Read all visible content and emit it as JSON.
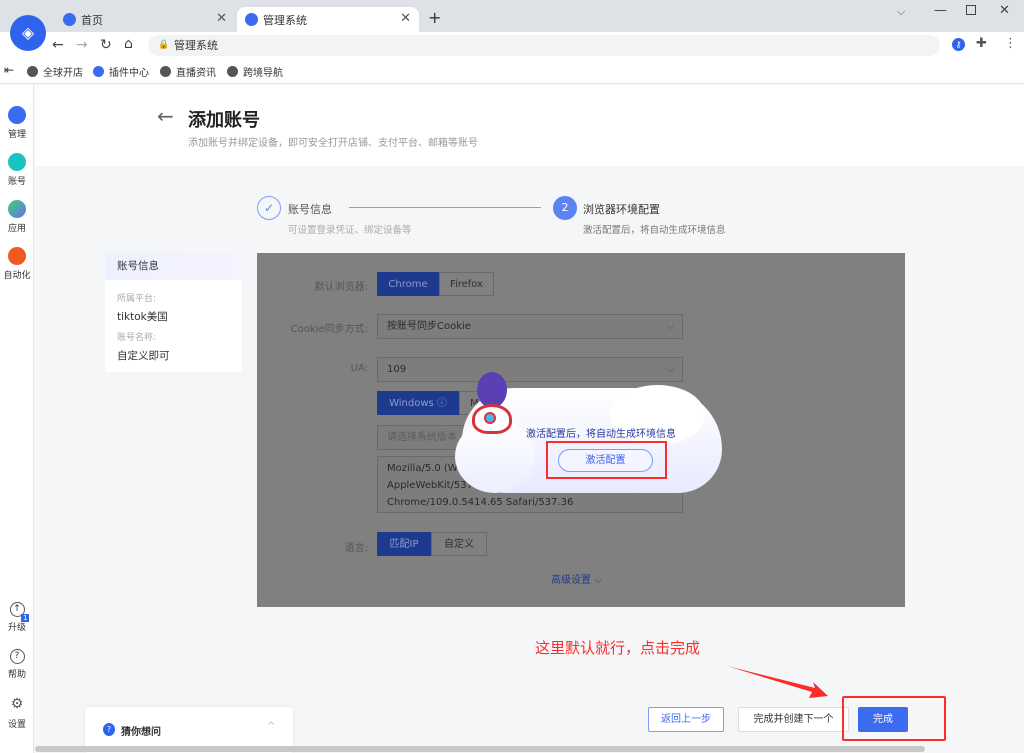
{
  "browser": {
    "tabs": [
      {
        "label": "首页",
        "active": false
      },
      {
        "label": "管理系统",
        "active": true
      }
    ],
    "address": "管理系统",
    "bookmarks": [
      "全球开店",
      "插件中心",
      "直播资讯",
      "跨境导航"
    ]
  },
  "sidebar": {
    "items": [
      {
        "label": "管理",
        "icon": "grid-icon"
      },
      {
        "label": "账号",
        "icon": "shop-icon"
      },
      {
        "label": "应用",
        "icon": "apps-icon"
      },
      {
        "label": "自动化",
        "icon": "robot-icon"
      }
    ],
    "bottom": [
      {
        "label": "升级",
        "badge": "1"
      },
      {
        "label": "帮助"
      },
      {
        "label": "设置"
      }
    ]
  },
  "header": {
    "title": "添加账号",
    "subtitle": "添加账号并绑定设备，即可安全打开店铺、支付平台、邮箱等账号"
  },
  "steps": [
    {
      "number": "1",
      "title": "账号信息",
      "desc": "可设置登录凭证、绑定设备等",
      "done": true
    },
    {
      "number": "2",
      "title": "浏览器环境配置",
      "desc": "激活配置后，将自动生成环境信息",
      "active": true
    }
  ],
  "info_card": {
    "title": "账号信息",
    "platform_label": "所属平台:",
    "platform": "tiktok美国",
    "name_label": "账号名称:",
    "name": "自定义即可"
  },
  "form": {
    "browser_label": "默认浏览器:",
    "browsers": [
      "Chrome",
      "Firefox"
    ],
    "cookie_label": "Cookie同步方式:",
    "cookie_value": "按账号同步Cookie",
    "ua_label": "UA:",
    "ua_value": "109",
    "os": [
      "Windows",
      "M"
    ],
    "os_placeholder": "请选择系统版本",
    "ua_lines": [
      "Mozilla/5.0 (W",
      "AppleWebKit/537.",
      "Chrome/109.0.5414.65 Safari/537.36"
    ],
    "lang_label": "语言:",
    "langs": [
      "匹配IP",
      "自定义"
    ],
    "advanced": "高级设置"
  },
  "popup": {
    "message": "激活配置后，将自动生成环境信息",
    "button": "激活配置"
  },
  "annotation": {
    "text": "这里默认就行，点击完成",
    "color": "#ff2a2a"
  },
  "footer": {
    "back": "返回上一步",
    "finish_next": "完成并创建下一个",
    "finish": "完成"
  },
  "help": {
    "title": "猜你想问"
  },
  "colors": {
    "primary": "#3b6cf0",
    "overlay": "#808080"
  }
}
